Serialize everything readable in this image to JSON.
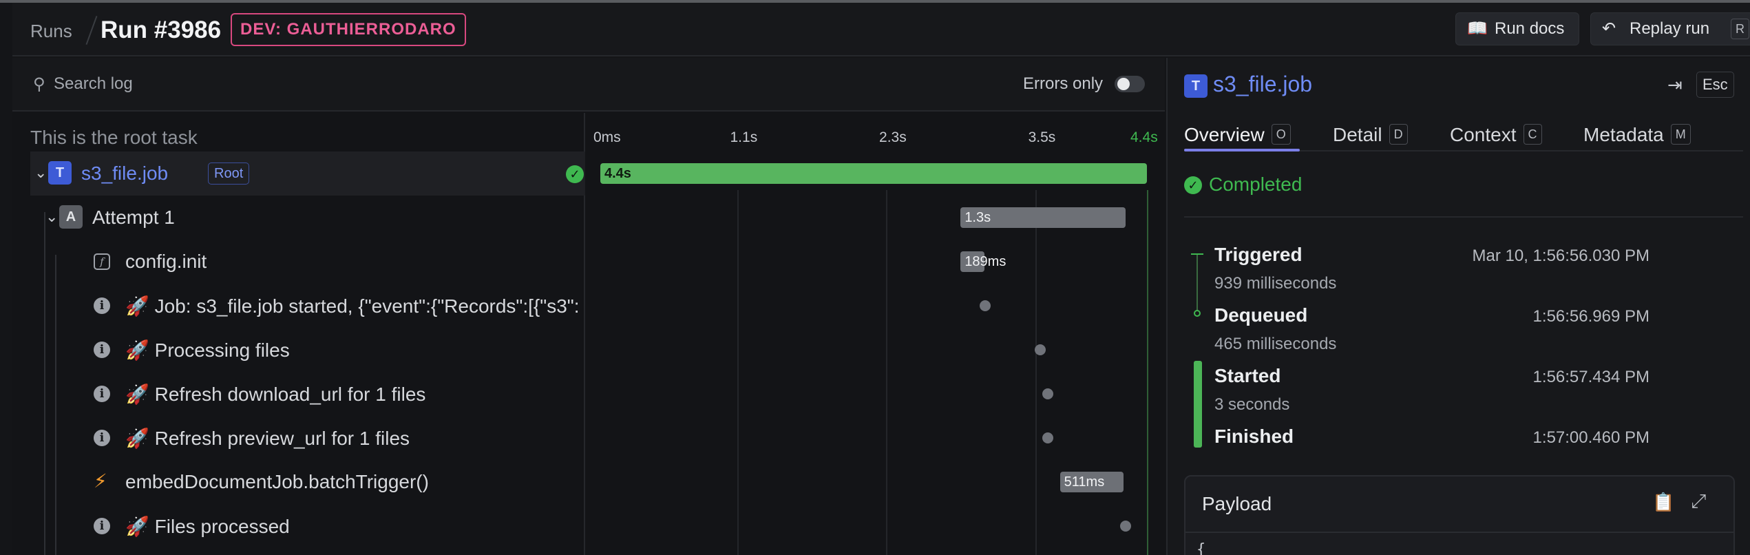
{
  "header": {
    "breadcrumb": "Runs",
    "title": "Run #3986",
    "env_badge": "DEV: GAUTHIERRODARO",
    "docs_button": "Run docs",
    "replay_button": "Replay run",
    "replay_shortcut": "R"
  },
  "log": {
    "search_placeholder": "Search log",
    "errors_only_label": "Errors only",
    "errors_only_enabled": false,
    "root_task_label": "This is the root task",
    "rows": [
      {
        "name": "s3_file.job",
        "icon": "T",
        "badge": "Root",
        "status": "completed"
      },
      {
        "name": "Attempt 1",
        "icon": "A"
      },
      {
        "name": "config.init",
        "icon": "function-icon"
      },
      {
        "name": "🚀 Job: s3_file.job started, {\"event\":{\"Records\":[{\"s3\":",
        "icon": "info-icon"
      },
      {
        "name": "🚀 Processing files",
        "icon": "info-icon"
      },
      {
        "name": "🚀 Refresh download_url for 1 files",
        "icon": "info-icon"
      },
      {
        "name": "🚀 Refresh preview_url for 1 files",
        "icon": "info-icon"
      },
      {
        "name": "embedDocumentJob.batchTrigger()",
        "icon": "bolt-icon"
      },
      {
        "name": "🚀 Files processed",
        "icon": "info-icon"
      }
    ]
  },
  "timeline": {
    "ticks": [
      "0ms",
      "1.1s",
      "2.3s",
      "3.5s",
      "4.4s"
    ],
    "total_s": 4.4,
    "spans": [
      {
        "row": 0,
        "start_s": 0,
        "end_s": 4.4,
        "label": "4.4s",
        "color": "#58b55f"
      },
      {
        "row": 1,
        "start_s": 2.9,
        "end_s": 4.23,
        "label": "1.3s",
        "color": "#6d7076"
      },
      {
        "row": 2,
        "start_s": 2.9,
        "end_s": 3.09,
        "label": "189ms",
        "color": "#6d7076"
      }
    ],
    "events": [
      {
        "row": 3,
        "at_s": 3.1
      },
      {
        "row": 4,
        "at_s": 3.54
      },
      {
        "row": 5,
        "at_s": 3.6
      },
      {
        "row": 6,
        "at_s": 3.6
      },
      {
        "row": 8,
        "at_s": 4.23
      }
    ],
    "span_batch": {
      "row": 7,
      "start_s": 3.7,
      "end_s": 4.21,
      "label": "511ms"
    }
  },
  "details": {
    "title": "s3_file.job",
    "close_shortcut": "Esc",
    "tabs": [
      {
        "label": "Overview",
        "shortcut": "O"
      },
      {
        "label": "Detail",
        "shortcut": "D"
      },
      {
        "label": "Context",
        "shortcut": "C"
      },
      {
        "label": "Metadata",
        "shortcut": "M"
      }
    ],
    "status": "Completed",
    "events": [
      {
        "name": "Triggered",
        "duration": "939 milliseconds",
        "time": "Mar 10, 1:56:56.030 PM"
      },
      {
        "name": "Dequeued",
        "duration": "465 milliseconds",
        "time": "1:56:56.969 PM"
      },
      {
        "name": "Started",
        "duration": "3 seconds",
        "time": "1:56:57.434 PM"
      },
      {
        "name": "Finished",
        "duration": "",
        "time": "1:57:00.460 PM"
      }
    ],
    "payload_title": "Payload",
    "payload_preview": "{"
  },
  "colors": {
    "accent_blue": "#6f8cf5",
    "success": "#3fb950",
    "env_pink": "#ec5e96",
    "tab_underline": "#7b7fe8"
  }
}
